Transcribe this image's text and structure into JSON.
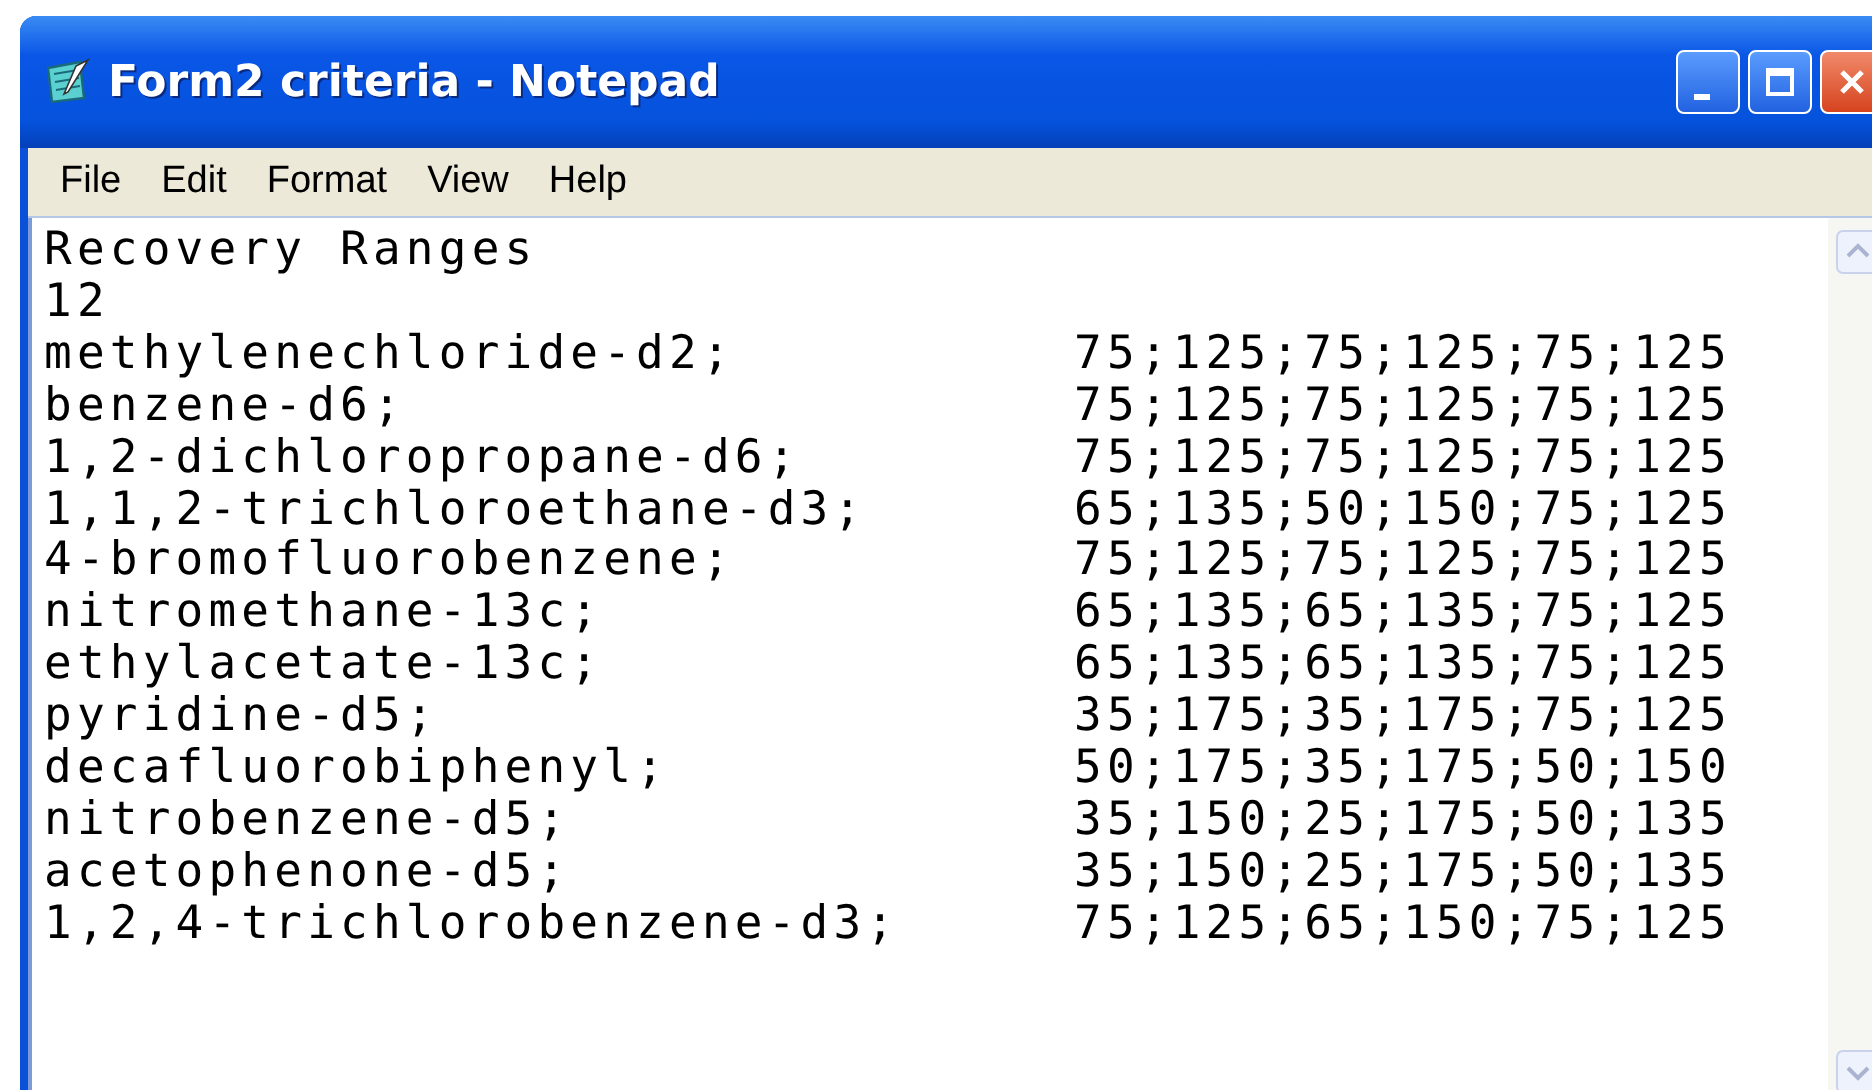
{
  "window": {
    "title": "Form2 criteria - Notepad"
  },
  "menu": [
    "File",
    "Edit",
    "Format",
    "View",
    "Help"
  ],
  "document": {
    "header_lines": [
      "Recovery Ranges",
      "12"
    ],
    "rows": [
      {
        "name": "methylenechloride-d2;",
        "values": "75;125;75;125;75;125"
      },
      {
        "name": "benzene-d6;",
        "values": "75;125;75;125;75;125"
      },
      {
        "name": "1,2-dichloropropane-d6;",
        "values": "75;125;75;125;75;125"
      },
      {
        "name": "1,1,2-trichloroethane-d3;",
        "values": "65;135;50;150;75;125"
      },
      {
        "name": "4-bromofluorobenzene;",
        "values": "75;125;75;125;75;125"
      },
      {
        "name": "nitromethane-13c;",
        "values": "65;135;65;135;75;125"
      },
      {
        "name": "ethylacetate-13c;",
        "values": "65;135;65;135;75;125"
      },
      {
        "name": "pyridine-d5;",
        "values": "35;175;35;175;75;125"
      },
      {
        "name": "decafluorobiphenyl;",
        "values": "50;175;35;175;50;150"
      },
      {
        "name": "nitrobenzene-d5;",
        "values": "35;150;25;175;50;135"
      },
      {
        "name": "acetophenone-d5;",
        "values": "35;150;25;175;50;135"
      },
      {
        "name": "1,2,4-trichlorobenzene-d3;",
        "values": "75;125;65;150;75;125"
      }
    ]
  }
}
